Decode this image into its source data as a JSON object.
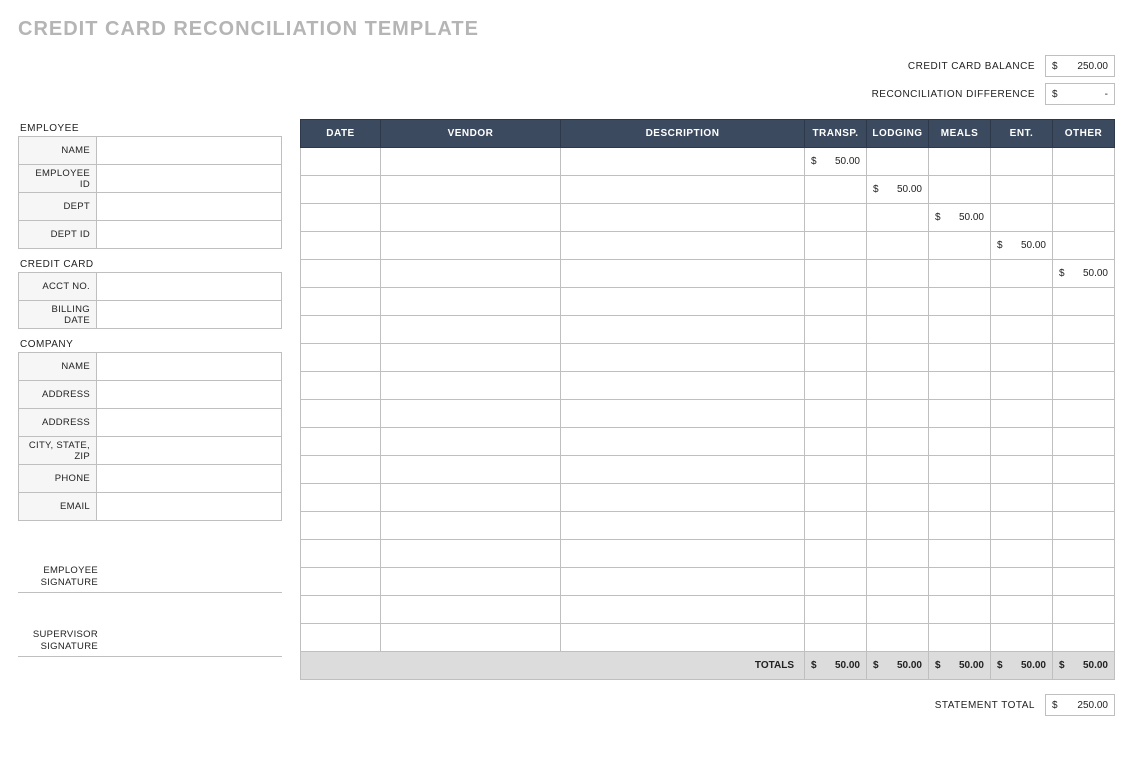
{
  "title": "CREDIT CARD RECONCILIATION TEMPLATE",
  "summary": {
    "balance_label": "CREDIT CARD BALANCE",
    "balance_cur": "$",
    "balance_val": "250.00",
    "diff_label": "RECONCILIATION DIFFERENCE",
    "diff_cur": "$",
    "diff_val": "-"
  },
  "sidebar": {
    "employee": {
      "heading": "EMPLOYEE",
      "rows": [
        "NAME",
        "EMPLOYEE ID",
        "DEPT",
        "DEPT ID"
      ]
    },
    "card": {
      "heading": "CREDIT CARD",
      "rows": [
        "ACCT NO.",
        "BILLING DATE"
      ]
    },
    "company": {
      "heading": "COMPANY",
      "rows": [
        "NAME",
        "ADDRESS",
        "ADDRESS",
        "CITY, STATE, ZIP",
        "PHONE",
        "EMAIL"
      ]
    },
    "signatures": {
      "employee": "EMPLOYEE SIGNATURE",
      "supervisor": "SUPERVISOR SIGNATURE"
    }
  },
  "grid": {
    "headers": [
      "DATE",
      "VENDOR",
      "DESCRIPTION",
      "TRANSP.",
      "LODGING",
      "MEALS",
      "ENT.",
      "OTHER"
    ],
    "rows": [
      {
        "transp": "50.00"
      },
      {
        "lodging": "50.00"
      },
      {
        "meals": "50.00"
      },
      {
        "ent": "50.00"
      },
      {
        "other": "50.00"
      },
      {},
      {},
      {},
      {},
      {},
      {},
      {},
      {},
      {},
      {},
      {},
      {},
      {}
    ],
    "totals_label": "TOTALS",
    "totals": {
      "transp": "50.00",
      "lodging": "50.00",
      "meals": "50.00",
      "ent": "50.00",
      "other": "50.00"
    }
  },
  "footer": {
    "stmt_label": "STATEMENT TOTAL",
    "stmt_cur": "$",
    "stmt_val": "250.00"
  },
  "currency": "$"
}
